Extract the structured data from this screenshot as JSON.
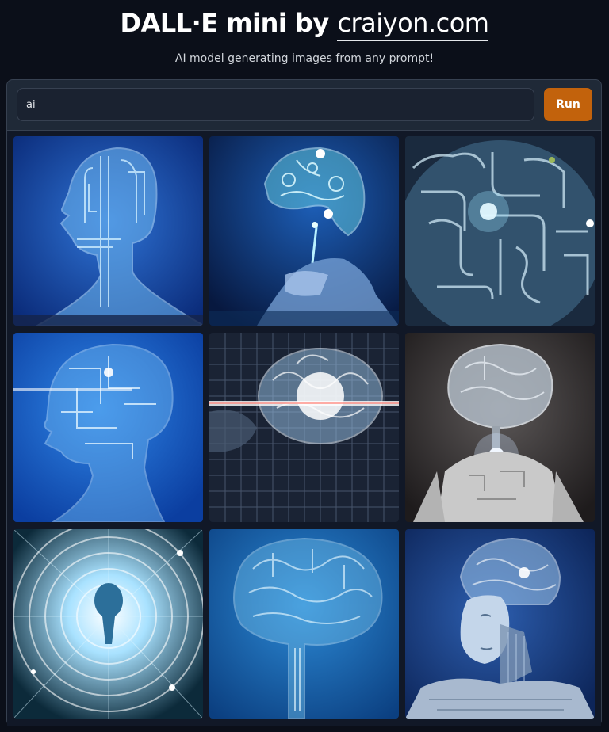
{
  "header": {
    "title_prefix": "DALL·E mini by ",
    "brand_link": "craiyon.com",
    "subtitle": "AI model generating images from any prompt!"
  },
  "prompt": {
    "value": "ai",
    "run_label": "Run"
  },
  "colors": {
    "accent": "#c2620c",
    "background": "#0b0f19",
    "panel": "#1f2937"
  },
  "gallery": {
    "images": [
      {
        "subject": "glass circuit head profile",
        "icon": "ai-head-profile-image"
      },
      {
        "subject": "glowing circuit brain held by hand",
        "icon": "brain-in-hand-image"
      },
      {
        "subject": "circuit maze brain closeup",
        "icon": "circuit-brain-closeup-image"
      },
      {
        "subject": "blue circuit head with light beam",
        "icon": "circuit-head-beam-image"
      },
      {
        "subject": "glowing brain in wire grid",
        "icon": "brain-grid-image"
      },
      {
        "subject": "robot with glass brain",
        "icon": "robot-brain-image"
      },
      {
        "subject": "head inside light tunnel",
        "icon": "light-tunnel-head-image"
      },
      {
        "subject": "glass brain silhouette",
        "icon": "glass-brain-image"
      },
      {
        "subject": "android face with circuit brain",
        "icon": "android-face-image"
      }
    ]
  }
}
